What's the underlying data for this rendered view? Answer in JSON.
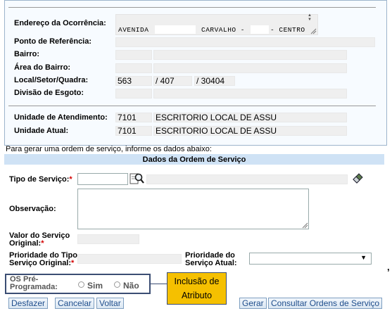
{
  "address": {
    "label": "Endereço da Ocorrência:",
    "street_type": "AVENIDA",
    "street_name": "CARVALHO -",
    "district_suffix": "- CENTRO",
    "scroll_up_glyph": "▲",
    "scroll_down_glyph": "▼"
  },
  "fields": {
    "reference_point_label": "Ponto de Referência:",
    "neighborhood_label": "Bairro:",
    "neighborhood_area_label": "Área do Bairro:",
    "sector_label": "Local/Setor/Quadra:",
    "local": "563",
    "sector": "/ 407",
    "block": "/ 30404",
    "sewage_division_label": "Divisão de Esgoto:",
    "service_unit_label": "Unidade de Atendimento:",
    "service_unit_code": "7101",
    "service_unit_name": "ESCRITORIO LOCAL DE ASSU",
    "current_unit_label": "Unidade Atual:",
    "current_unit_code": "7101",
    "current_unit_name": "ESCRITORIO LOCAL DE ASSU"
  },
  "instructions": "Para gerar uma ordem de serviço, informe os dados abaixo:",
  "section_title": "Dados da Ordem de Serviço",
  "order": {
    "service_type_label": "Tipo de Serviço:",
    "required_mark": "*",
    "service_type_value": "",
    "observation_label": "Observação:",
    "original_value_label_1": "Valor do Serviço",
    "original_value_label_2": "Original:",
    "orig_priority_label_1": "Prioridade do Tipo",
    "orig_priority_label_2": "Serviço Original:",
    "current_priority_label_1": "Prioridade do",
    "current_priority_label_2": "Serviço Atual:",
    "current_priority_value": "",
    "preprog_label_1": "OS Pré-",
    "preprog_label_2": "Programada:",
    "opt_yes": "Sim",
    "opt_no": "Não"
  },
  "callout": {
    "line1": "Inclusão de",
    "line2": "Atributo"
  },
  "buttons": {
    "undo": "Desfazer",
    "cancel": "Cancelar",
    "back": "Voltar",
    "generate": "Gerar",
    "consult": "Consultar Ordens de Serviço"
  },
  "colors": {
    "section_header_bg": "#cfe2f5",
    "highlight_border": "#3b4d73",
    "callout_bg": "#f5c000",
    "button_text": "#1f4e8c"
  }
}
